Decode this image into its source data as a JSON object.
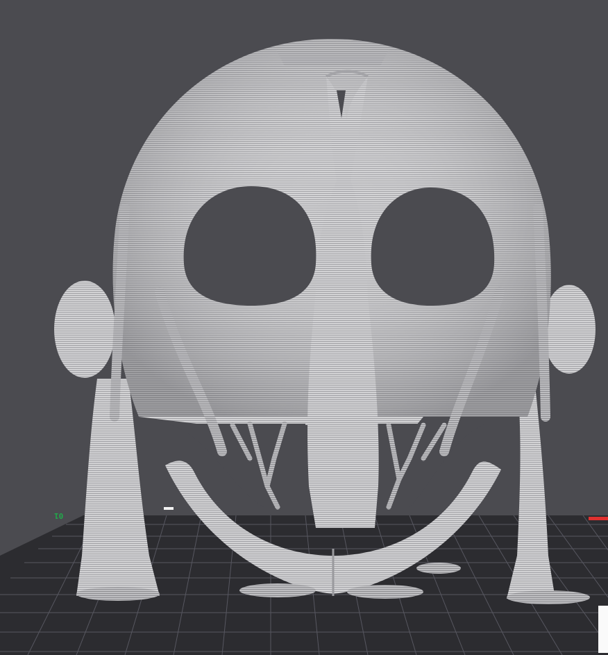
{
  "viewport": {
    "background": "#4b4b50",
    "model_color": "#cfcfd1",
    "model_line_color": "#9c9ca0",
    "bed_color": "#2c2c30",
    "bed_grid_color": "#575760"
  },
  "axes": {
    "y_label": "01",
    "y_color": "#21a94a",
    "x_color": "#e0312f",
    "z_label": "",
    "z_icon": "ruler-icon"
  }
}
